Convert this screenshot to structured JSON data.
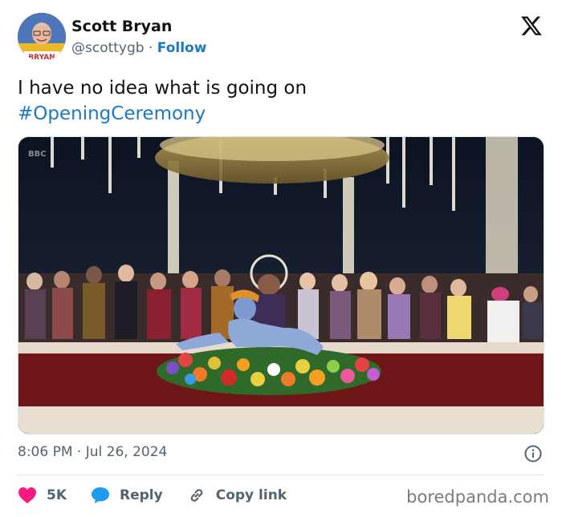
{
  "author": {
    "name": "Scott Bryan",
    "handle": "@scottygb",
    "separator": "·",
    "follow_label": "Follow",
    "avatar_caption": "BRYAN"
  },
  "post": {
    "text": "I have no idea what is going on",
    "hashtag": "#OpeningCeremony",
    "timestamp": "8:06 PM · Jul 26, 2024"
  },
  "media": {
    "broadcaster_tag": "BBC"
  },
  "actions": {
    "like_count": "5K",
    "reply_label": "Reply",
    "copy_link_label": "Copy link"
  },
  "watermark": "boredpanda.com",
  "colors": {
    "link_blue": "#1d78c2",
    "like_pink": "#f91880",
    "reply_blue": "#1d9bf0",
    "muted_text": "#536471"
  },
  "icons": [
    "x-logo-icon",
    "info-icon",
    "heart-icon",
    "speech-bubble-icon",
    "link-icon"
  ]
}
